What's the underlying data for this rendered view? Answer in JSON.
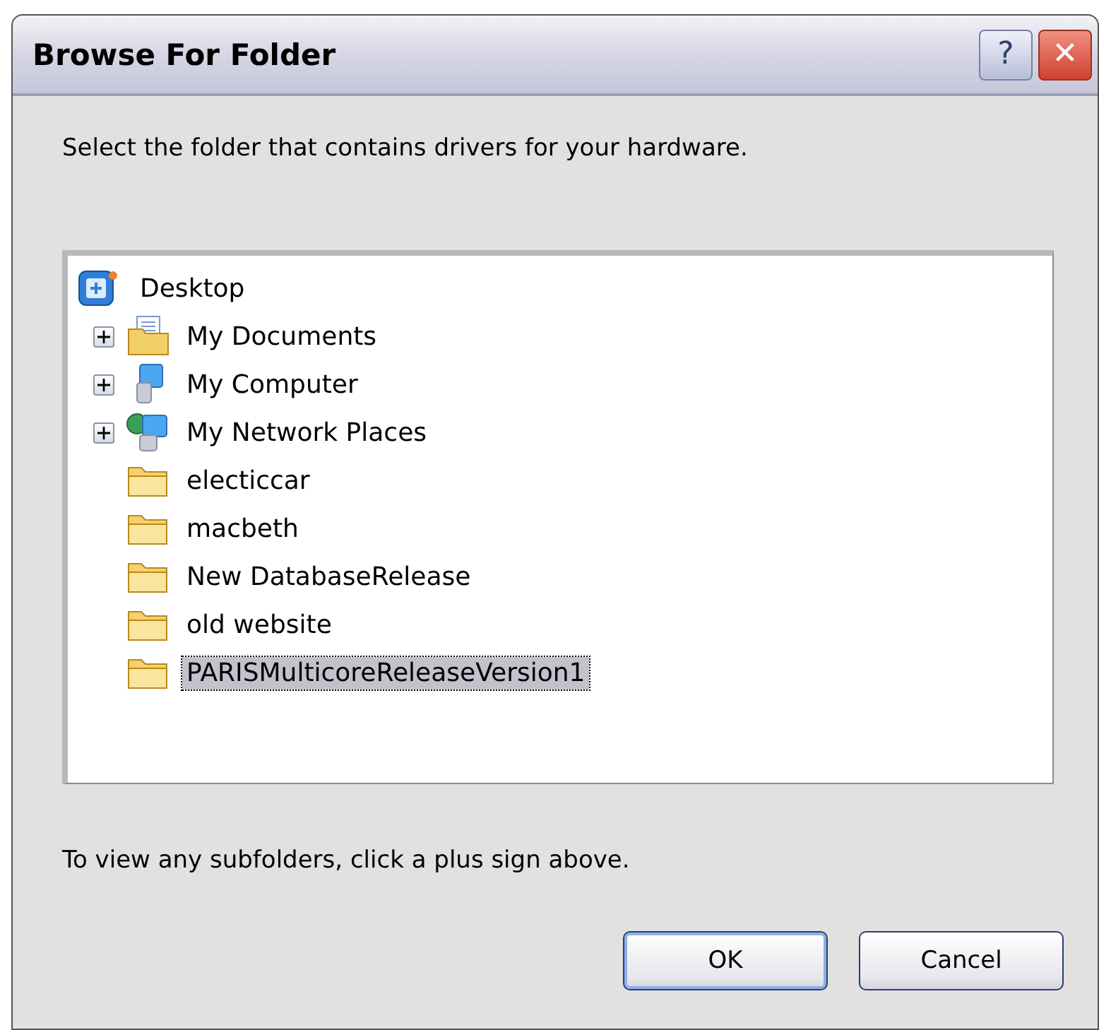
{
  "window": {
    "title": "Browse For Folder",
    "buttons": [
      "?",
      "✕"
    ]
  },
  "instruction": "Select the folder that contains drivers for your hardware.",
  "tree": {
    "items": [
      {
        "label": "Desktop",
        "kind": "desktop",
        "expandable": false,
        "selected": false
      },
      {
        "label": "My Documents",
        "kind": "documents",
        "expandable": true,
        "selected": false
      },
      {
        "label": "My Computer",
        "kind": "computer",
        "expandable": true,
        "selected": false
      },
      {
        "label": "My Network Places",
        "kind": "network",
        "expandable": true,
        "selected": false
      },
      {
        "label": "electiccar",
        "kind": "folder",
        "expandable": false,
        "selected": false
      },
      {
        "label": "macbeth",
        "kind": "folder",
        "expandable": false,
        "selected": false
      },
      {
        "label": "New DatabaseRelease",
        "kind": "folder",
        "expandable": false,
        "selected": false
      },
      {
        "label": "old website",
        "kind": "folder",
        "expandable": false,
        "selected": false
      },
      {
        "label": "PARISMulticoreReleaseVersion1",
        "kind": "folder",
        "expandable": false,
        "selected": true
      }
    ]
  },
  "hint": "To view any subfolders, click a plus sign above.",
  "buttons": [
    {
      "label": "OK",
      "default": true
    },
    {
      "label": "Cancel",
      "default": false
    }
  ]
}
